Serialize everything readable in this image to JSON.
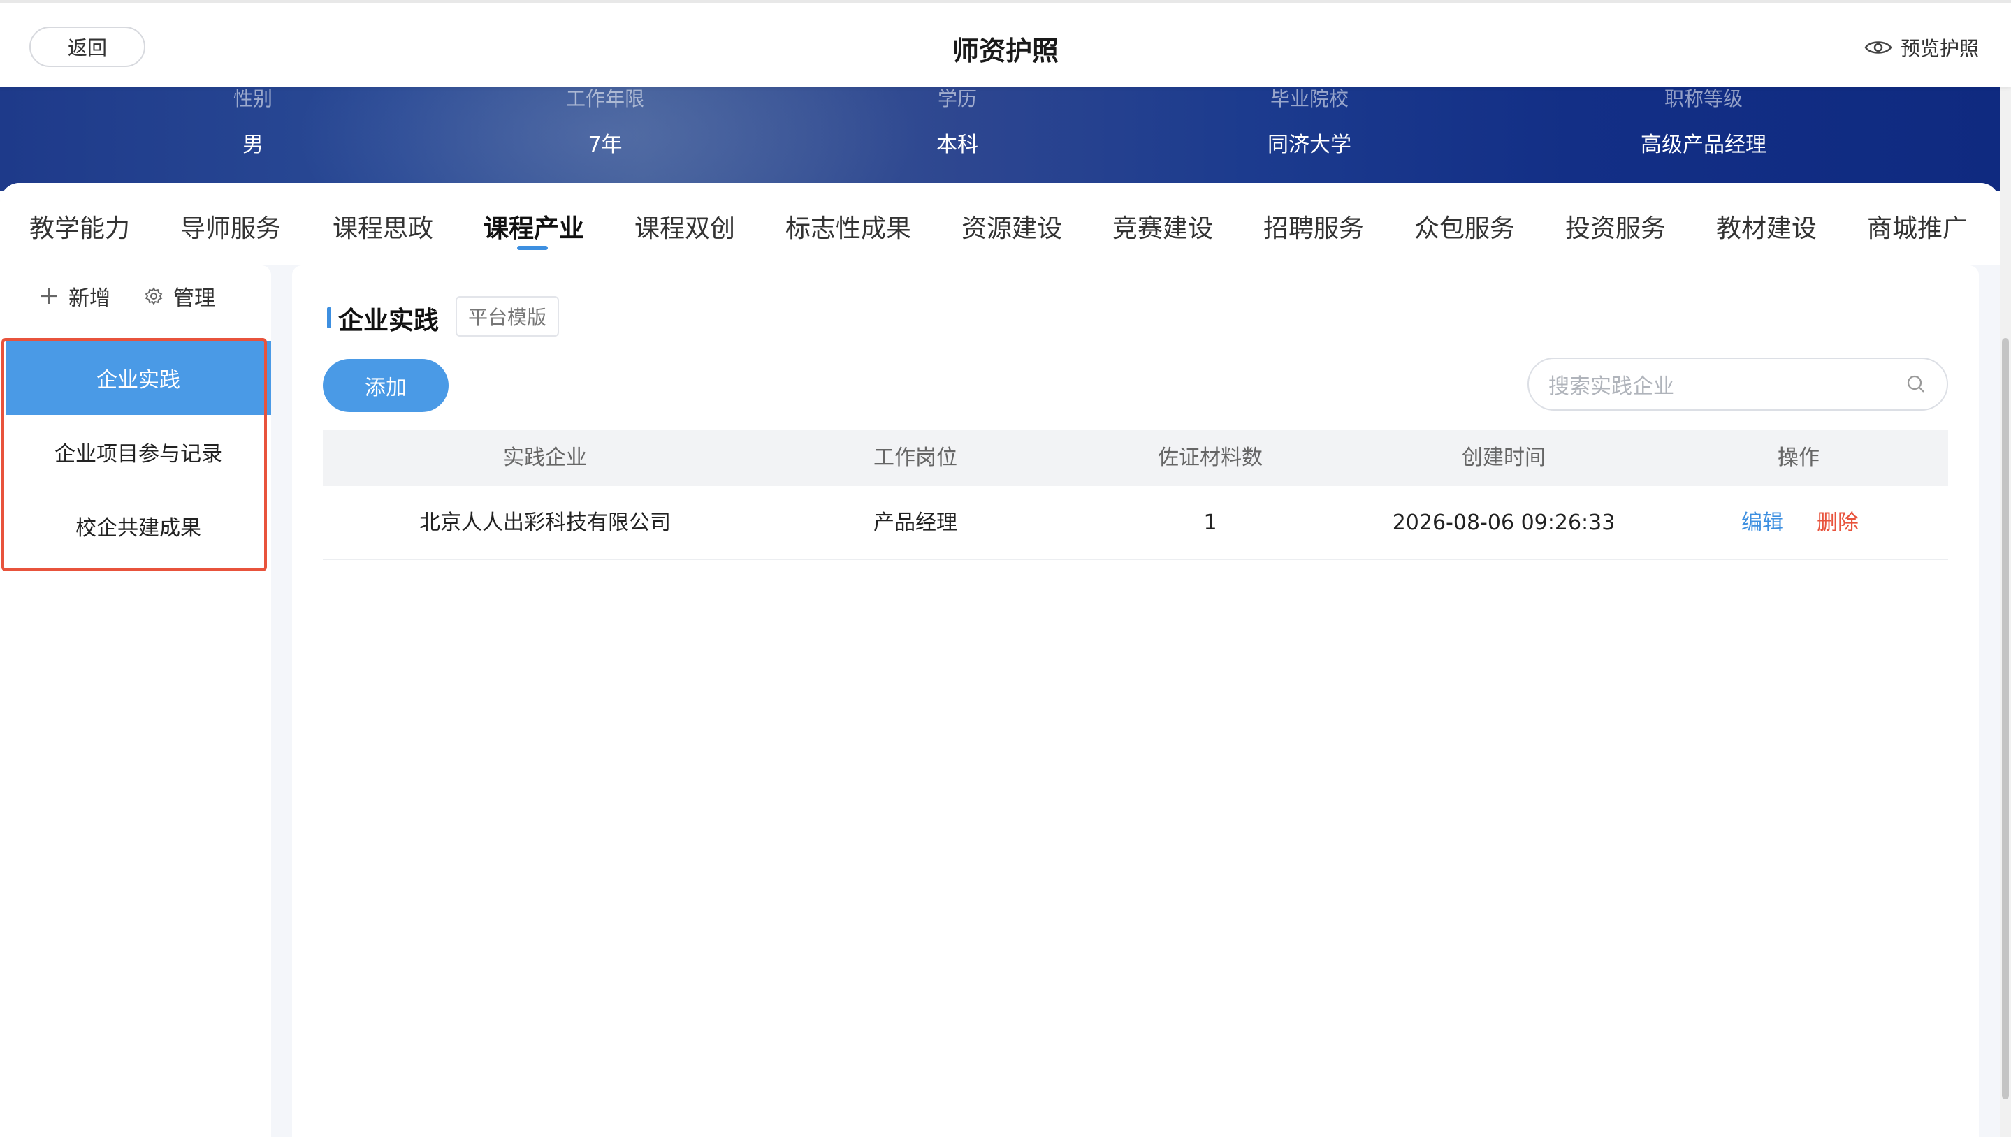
{
  "header": {
    "back_label": "返回",
    "title": "师资护照",
    "preview_label": "预览护照"
  },
  "profile": [
    {
      "label": "性别",
      "value": "男"
    },
    {
      "label": "工作年限",
      "value": "7年"
    },
    {
      "label": "学历",
      "value": "本科"
    },
    {
      "label": "毕业院校",
      "value": "同济大学"
    },
    {
      "label": "职称等级",
      "value": "高级产品经理"
    }
  ],
  "tabs": [
    {
      "label": "教学能力"
    },
    {
      "label": "导师服务"
    },
    {
      "label": "课程思政"
    },
    {
      "label": "课程产业",
      "active": true
    },
    {
      "label": "课程双创"
    },
    {
      "label": "标志性成果"
    },
    {
      "label": "资源建设"
    },
    {
      "label": "竞赛建设"
    },
    {
      "label": "招聘服务"
    },
    {
      "label": "众包服务"
    },
    {
      "label": "投资服务"
    },
    {
      "label": "教材建设"
    },
    {
      "label": "商城推广"
    }
  ],
  "sidebar": {
    "add_label": "新增",
    "manage_label": "管理",
    "items": [
      {
        "label": "企业实践",
        "active": true
      },
      {
        "label": "企业项目参与记录"
      },
      {
        "label": "校企共建成果"
      }
    ]
  },
  "main": {
    "section_title": "企业实践",
    "template_tag": "平台模版",
    "add_button": "添加",
    "search_placeholder": "搜索实践企业",
    "columns": [
      "实践企业",
      "工作岗位",
      "佐证材料数",
      "创建时间",
      "操作"
    ],
    "rows": [
      {
        "company": "北京人人出彩科技有限公司",
        "position": "产品经理",
        "evidence_count": "1",
        "created_at": "2026-08-06 09:26:33",
        "edit_label": "编辑",
        "delete_label": "删除"
      }
    ]
  },
  "colors": {
    "accent": "#4a9ae6",
    "danger": "#e8533c",
    "banner": "#1c3b8e"
  },
  "icons": {
    "preview": "eye-icon",
    "add": "plus-icon",
    "manage": "gear-icon",
    "search": "search-icon"
  }
}
